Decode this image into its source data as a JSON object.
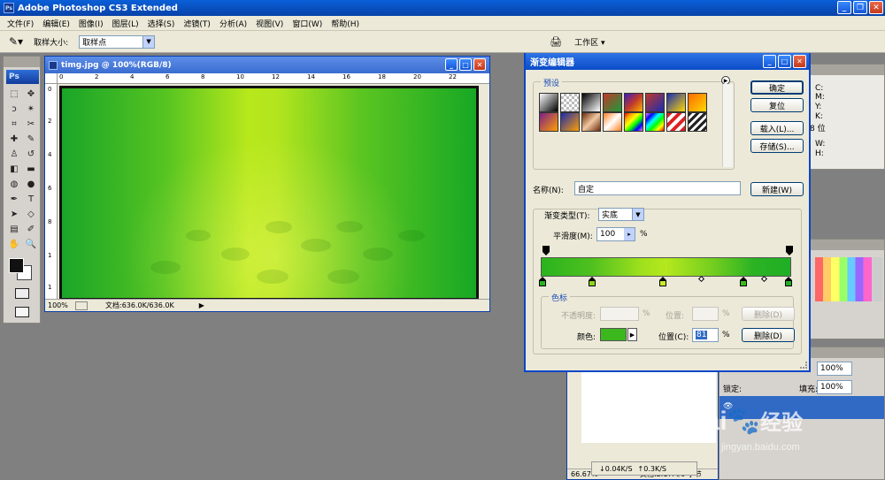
{
  "app": {
    "title": "Adobe Photoshop CS3 Extended",
    "logo": "Ps"
  },
  "menu": [
    "文件(F)",
    "编辑(E)",
    "图像(I)",
    "图层(L)",
    "选择(S)",
    "滤镜(T)",
    "分析(A)",
    "视图(V)",
    "窗口(W)",
    "帮助(H)"
  ],
  "options": {
    "sample_label": "取样大小:",
    "sample_value": "取样点",
    "workspace": "工作区 ▾"
  },
  "doc": {
    "title": "timg.jpg @ 100%(RGB/8)",
    "zoom": "100%",
    "docsize": "文档:636.0K/636.0K",
    "ruler_top": [
      "0",
      "2",
      "4",
      "6",
      "8",
      "10",
      "12",
      "14",
      "16",
      "18",
      "20",
      "22"
    ],
    "ruler_left": [
      "0",
      "2",
      "4",
      "6",
      "8",
      "1",
      "1"
    ]
  },
  "dialog": {
    "title": "渐变编辑器",
    "presets_label": "预设",
    "ok": "确定",
    "reset": "复位",
    "load": "载入(L)...",
    "save": "存储(S)...",
    "name_label": "名称(N):",
    "name_value": "自定",
    "new": "新建(W)",
    "type_label": "渐变类型(T):",
    "type_value": "实底",
    "smooth_label": "平滑度(M):",
    "smooth_value": "100",
    "percent": "%",
    "stops_label": "色标",
    "opacity_label": "不透明度:",
    "location_label": "位置:",
    "delete": "删除(D)",
    "color_label": "颜色:",
    "color_location_label": "位置(C):",
    "color_location_value": "81",
    "color_swatch": "#3cb81e"
  },
  "swatches": [
    "#000000",
    "#808080",
    "#111111",
    "#c0392b",
    "#6b2a0e",
    "#8b0a2a",
    "#1a2bb0",
    "#e8a200",
    "#7a1f8a",
    "#ff6a00",
    "#b36a3d",
    "#ff7d1f",
    "#ff2020",
    "#e02020",
    "#c0c0c0",
    "#222222"
  ],
  "right_panel": {
    "info": [
      "C:",
      "M:",
      "Y:",
      "K:",
      "8 位",
      "W:",
      "H:"
    ],
    "layer_opacity": "100%",
    "lock": "锁定:",
    "fill_label": "填充:",
    "fill_value": "100%"
  },
  "minwin": {
    "zoom": "66.67%",
    "docsize": "文档:2.17M/0 字节"
  },
  "net": {
    "down": "0.04K/S",
    "up": "0.3K/S"
  },
  "watermark": {
    "brand": "Bai",
    "brand2": "经验",
    "url": "jingyan.baidu.com"
  }
}
